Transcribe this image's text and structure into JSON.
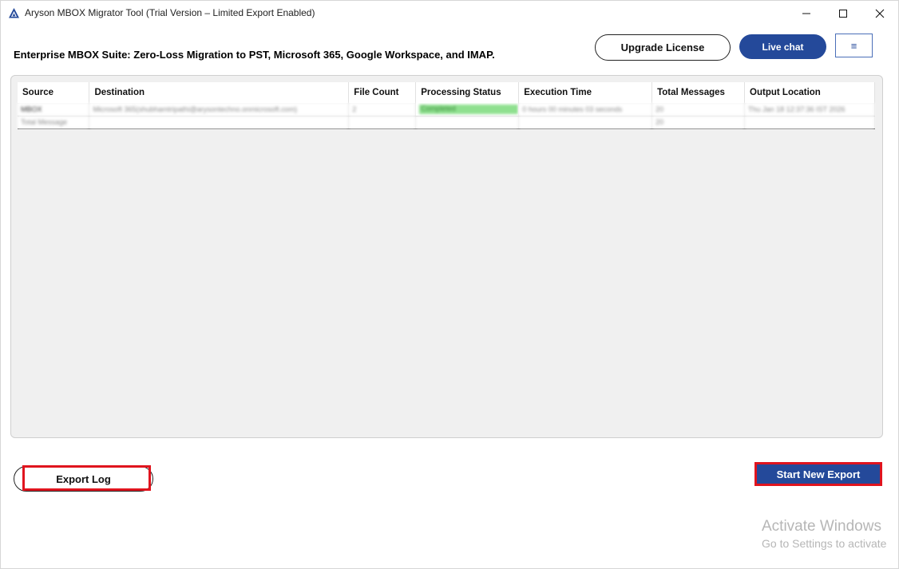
{
  "window": {
    "title": "Aryson MBOX Migrator Tool (Trial Version – Limited Export Enabled)",
    "controls": {
      "minimize": "minimize-icon",
      "maximize": "maximize-icon",
      "close": "close-icon"
    }
  },
  "header": {
    "suite_title": "Enterprise MBOX Suite: Zero-Loss Migration to PST, Microsoft 365, Google Workspace, and IMAP.",
    "upgrade_label": "Upgrade License",
    "livechat_label": "Live chat",
    "menu_icon": "≡"
  },
  "table": {
    "columns": [
      "Source",
      "Destination",
      "File Count",
      "Processing Status",
      "Execution Time",
      "Total Messages",
      "Output Location"
    ],
    "rows": [
      {
        "source": "MBOX",
        "destination": "Microsoft 365(shubhamtripathi@arysontechno.onmicrosoft.com)",
        "file_count": "2",
        "status": "Completed",
        "execution_time": "0 hours 00 minutes 03 seconds",
        "total_messages": "20",
        "output_location": "Thu Jan 18 12:37:36 IST 2026"
      },
      {
        "source": "Total Message",
        "destination": "",
        "file_count": "",
        "status": "",
        "execution_time": "",
        "total_messages": "20",
        "output_location": ""
      }
    ]
  },
  "footer": {
    "export_log_label": "Export Log",
    "start_new_label": "Start New Export"
  },
  "watermark": {
    "title": "Activate Windows",
    "subtitle": "Go to Settings to activate"
  },
  "colors": {
    "brand_blue": "#24499a",
    "highlight_red": "#e0141e",
    "status_green": "#8fe08f"
  }
}
